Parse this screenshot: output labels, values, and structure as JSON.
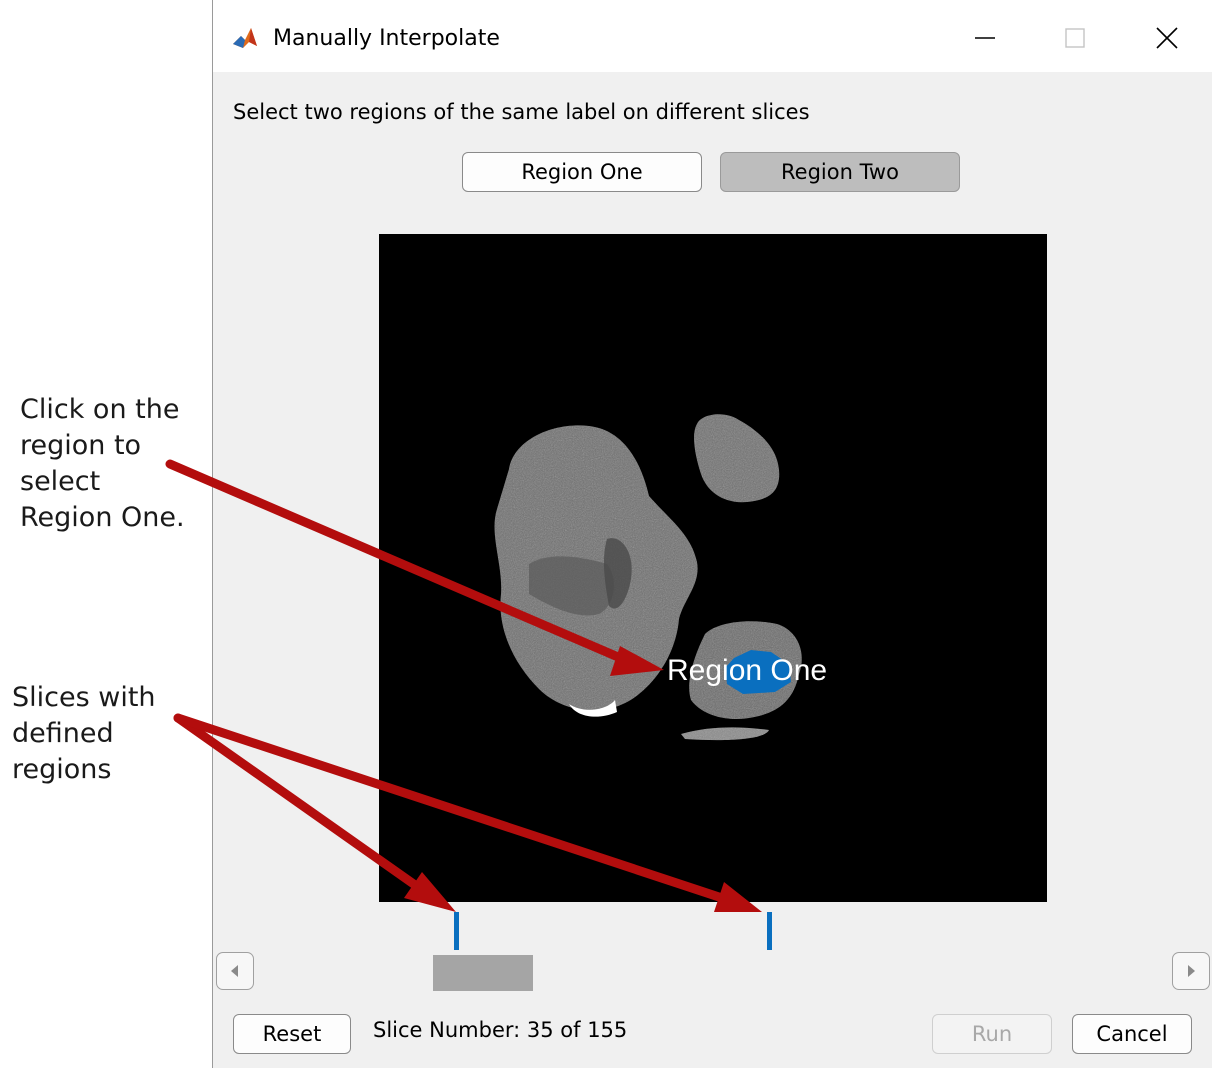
{
  "window": {
    "title": "Manually Interpolate",
    "icon": "matlab-logo-icon",
    "controls": [
      "minimize-icon",
      "maximize-icon",
      "close-icon"
    ]
  },
  "instruction": "Select two regions of the same label on different slices",
  "region_buttons": {
    "one_label": "Region One",
    "two_label": "Region Two",
    "active": "Region Two"
  },
  "viewer": {
    "overlay_label": "Region One",
    "selection_color": "#0a6fbf"
  },
  "slice_markers_color": "#0a6fbf",
  "footer": {
    "reset_label": "Reset",
    "slice_status": "Slice Number: 35 of 155",
    "run_label": "Run",
    "cancel_label": "Cancel"
  },
  "annotations": {
    "click_hint": "Click on the\nregion to\nselect\nRegion One.",
    "slices_hint": "Slices with\ndefined\nregions",
    "arrow_color": "#b30d0d"
  }
}
